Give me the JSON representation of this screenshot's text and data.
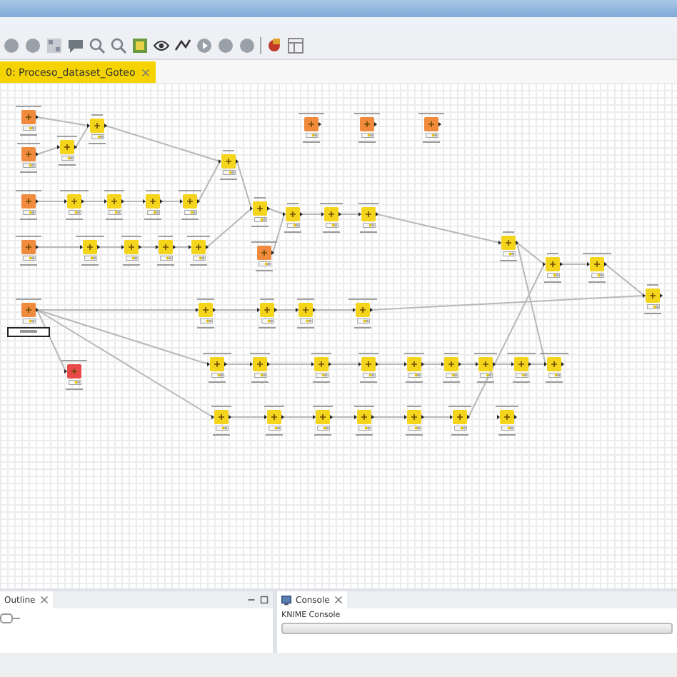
{
  "editor_tab": {
    "label": "0: Proceso_dataset_Goteo",
    "selected": true
  },
  "nodes": [
    {
      "kind": "source",
      "editing": false
    },
    {
      "kind": "source",
      "editing": false
    },
    {
      "kind": "manipulator",
      "editing": false
    },
    {
      "kind": "manipulator",
      "editing": false
    },
    {
      "kind": "manipulator",
      "editing": false
    },
    {
      "kind": "source",
      "editing": false
    },
    {
      "kind": "manipulator",
      "editing": false
    },
    {
      "kind": "manipulator",
      "editing": false
    },
    {
      "kind": "manipulator",
      "editing": false
    },
    {
      "kind": "manipulator",
      "editing": false
    },
    {
      "kind": "source",
      "editing": false
    },
    {
      "kind": "manipulator",
      "editing": false
    },
    {
      "kind": "manipulator",
      "editing": false
    },
    {
      "kind": "manipulator",
      "editing": false
    },
    {
      "kind": "manipulator",
      "editing": false
    },
    {
      "kind": "manipulator",
      "editing": false
    },
    {
      "kind": "source",
      "editing": false
    },
    {
      "kind": "manipulator",
      "editing": false
    },
    {
      "kind": "manipulator",
      "editing": false
    },
    {
      "kind": "manipulator",
      "editing": false
    },
    {
      "kind": "source",
      "editing": false
    },
    {
      "kind": "source",
      "editing": false
    },
    {
      "kind": "source",
      "editing": false
    },
    {
      "kind": "manipulator",
      "editing": false
    },
    {
      "kind": "manipulator",
      "editing": false
    },
    {
      "kind": "manipulator",
      "editing": false
    },
    {
      "kind": "manipulator",
      "editing": false
    },
    {
      "kind": "source",
      "editing": true
    },
    {
      "kind": "sink",
      "editing": false
    },
    {
      "kind": "manipulator",
      "editing": false
    },
    {
      "kind": "manipulator",
      "editing": false
    },
    {
      "kind": "manipulator",
      "editing": false
    },
    {
      "kind": "manipulator",
      "editing": false
    },
    {
      "kind": "manipulator",
      "editing": false
    },
    {
      "kind": "manipulator",
      "editing": false
    },
    {
      "kind": "manipulator",
      "editing": false
    },
    {
      "kind": "manipulator",
      "editing": false
    },
    {
      "kind": "manipulator",
      "editing": false
    },
    {
      "kind": "manipulator",
      "editing": false
    },
    {
      "kind": "manipulator",
      "editing": false
    },
    {
      "kind": "manipulator",
      "editing": false
    },
    {
      "kind": "manipulator",
      "editing": false
    },
    {
      "kind": "manipulator",
      "editing": false
    },
    {
      "kind": "manipulator",
      "editing": false
    },
    {
      "kind": "manipulator",
      "editing": false
    },
    {
      "kind": "manipulator",
      "editing": false
    },
    {
      "kind": "manipulator",
      "editing": false
    },
    {
      "kind": "manipulator",
      "editing": false
    },
    {
      "kind": "manipulator",
      "editing": false
    }
  ],
  "outline": {
    "title": "Outline"
  },
  "console": {
    "title": "Console",
    "heading": "KNIME Console"
  }
}
